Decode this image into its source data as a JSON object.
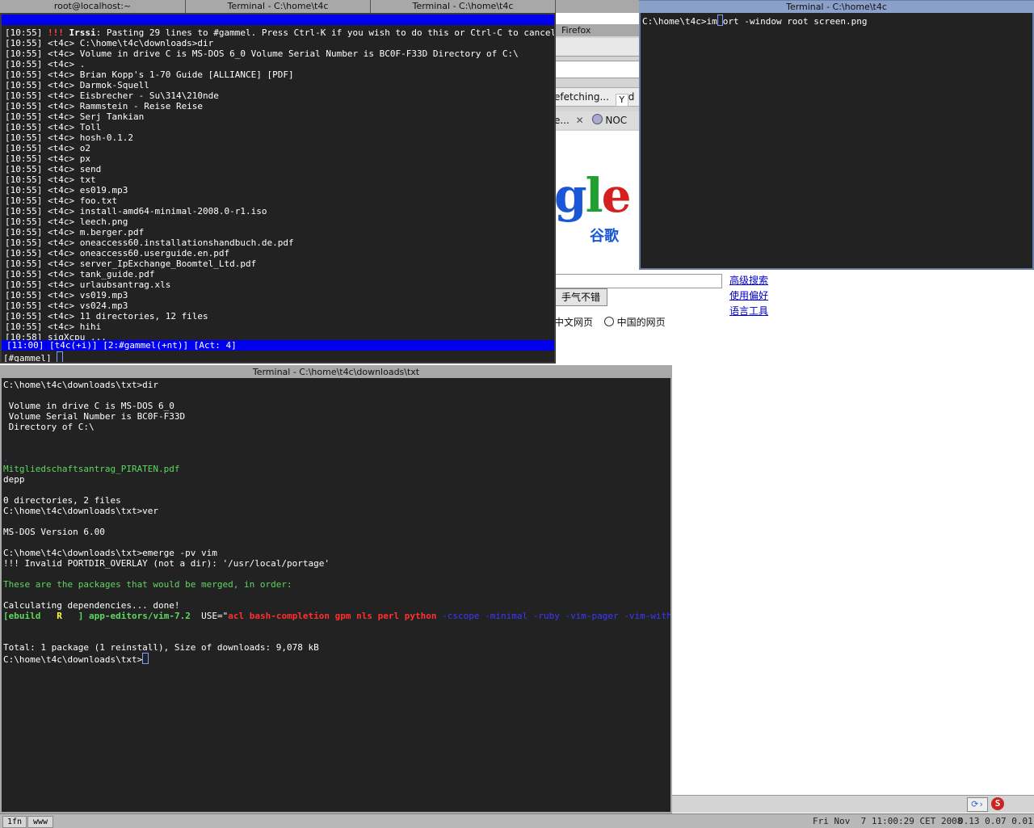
{
  "tabs": [
    {
      "label": "root@localhost:~"
    },
    {
      "label": "Terminal - C:\\home\\t4c"
    },
    {
      "label": "Terminal - C:\\home\\t4c"
    }
  ],
  "irssi": {
    "lines": [
      {
        "ts": "[10:55]",
        "nick": "",
        "text": "",
        "special": "paste"
      },
      {
        "ts": "[10:55]",
        "nick": "<t4c>",
        "text": "C:\\home\\t4c\\downloads>dir"
      },
      {
        "ts": "[10:55]",
        "nick": "<t4c>",
        "text": "Volume in drive C is MS-DOS 6_0 Volume Serial Number is BC0F-F33D Directory of C:\\"
      },
      {
        "ts": "[10:55]",
        "nick": "<t4c>",
        "text": "."
      },
      {
        "ts": "[10:55]",
        "nick": "<t4c>",
        "text": "Brian Kopp's 1-70 Guide [ALLIANCE] [PDF]"
      },
      {
        "ts": "[10:55]",
        "nick": "<t4c>",
        "text": "Darmok-Squell"
      },
      {
        "ts": "[10:55]",
        "nick": "<t4c>",
        "text": "Eisbrecher - Su\\314\\210nde"
      },
      {
        "ts": "[10:55]",
        "nick": "<t4c>",
        "text": "Rammstein - Reise Reise"
      },
      {
        "ts": "[10:55]",
        "nick": "<t4c>",
        "text": "Serj Tankian"
      },
      {
        "ts": "[10:55]",
        "nick": "<t4c>",
        "text": "Toll"
      },
      {
        "ts": "[10:55]",
        "nick": "<t4c>",
        "text": "hosh-0.1.2"
      },
      {
        "ts": "[10:55]",
        "nick": "<t4c>",
        "text": "o2"
      },
      {
        "ts": "[10:55]",
        "nick": "<t4c>",
        "text": "px"
      },
      {
        "ts": "[10:55]",
        "nick": "<t4c>",
        "text": "send"
      },
      {
        "ts": "[10:55]",
        "nick": "<t4c>",
        "text": "txt"
      },
      {
        "ts": "[10:55]",
        "nick": "<t4c>",
        "text": "es019.mp3"
      },
      {
        "ts": "[10:55]",
        "nick": "<t4c>",
        "text": "foo.txt"
      },
      {
        "ts": "[10:55]",
        "nick": "<t4c>",
        "text": "install-amd64-minimal-2008.0-r1.iso"
      },
      {
        "ts": "[10:55]",
        "nick": "<t4c>",
        "text": "leech.png"
      },
      {
        "ts": "[10:55]",
        "nick": "<t4c>",
        "text": "m.berger.pdf"
      },
      {
        "ts": "[10:55]",
        "nick": "<t4c>",
        "text": "oneaccess60.installationshandbuch.de.pdf"
      },
      {
        "ts": "[10:55]",
        "nick": "<t4c>",
        "text": "oneaccess60.userguide.en.pdf"
      },
      {
        "ts": "[10:55]",
        "nick": "<t4c>",
        "text": "server_IpExchange_Boomtel_Ltd.pdf"
      },
      {
        "ts": "[10:55]",
        "nick": "<t4c>",
        "text": "tank_guide.pdf"
      },
      {
        "ts": "[10:55]",
        "nick": "<t4c>",
        "text": "urlaubsantrag.xls"
      },
      {
        "ts": "[10:55]",
        "nick": "<t4c>",
        "text": "vs019.mp3"
      },
      {
        "ts": "[10:55]",
        "nick": "<t4c>",
        "text": "vs024.mp3"
      },
      {
        "ts": "[10:55]",
        "nick": "<t4c>",
        "text": "11 directories, 12 files"
      },
      {
        "ts": "[10:55]",
        "nick": "<t4c>",
        "text": "hihi"
      },
      {
        "ts": "[10:58]",
        "nick": "",
        "text": "sigXcpu ...",
        "special": "action"
      }
    ],
    "paste_prefix": "!!!",
    "paste_app": "Irssi",
    "paste_msg": ": Pasting 29 lines to #gammel. Press Ctrl-K if you wish to do this or Ctrl-C to cancel.",
    "status_line": "[11:00] [t4c(+i)] [2:#gammel(+nt)] [Act: 4]",
    "prompt": "[#gammel]"
  },
  "term_right": {
    "title": "Terminal - C:\\home\\t4c",
    "prompt": "C:\\home\\t4c>im",
    "command_rest": "ort -window root screen.png"
  },
  "term_main": {
    "title": "Terminal - C:\\home\\t4c\\downloads\\txt",
    "lines": [
      {
        "text": "C:\\home\\t4c\\downloads\\txt>dir",
        "color": "white"
      },
      {
        "text": "",
        "color": "white"
      },
      {
        "text": " Volume in drive C is MS-DOS 6_0",
        "color": "white"
      },
      {
        "text": " Volume Serial Number is BC0F-F33D",
        "color": "white"
      },
      {
        "text": " Directory of C:\\",
        "color": "white"
      },
      {
        "text": "",
        "color": "white"
      },
      {
        "text": "",
        "color": "white"
      },
      {
        "text": ".",
        "color": "blue"
      },
      {
        "text": "Mitgliedschaftsantrag_PIRATEN.pdf",
        "color": "green"
      },
      {
        "text": "depp",
        "color": "white"
      },
      {
        "text": "",
        "color": "white"
      },
      {
        "text": "0 directories, 2 files",
        "color": "white"
      },
      {
        "text": "C:\\home\\t4c\\downloads\\txt>ver",
        "color": "white"
      },
      {
        "text": "",
        "color": "white"
      },
      {
        "text": "MS-DOS Version 6.00",
        "color": "white"
      },
      {
        "text": "",
        "color": "white"
      },
      {
        "text": "C:\\home\\t4c\\downloads\\txt>emerge -pv vim",
        "color": "white"
      },
      {
        "text": "!!! Invalid PORTDIR_OVERLAY (not a dir): '/usr/local/portage'",
        "color": "white"
      },
      {
        "text": "",
        "color": "white"
      },
      {
        "text": "These are the packages that would be merged, in order:",
        "color": "green"
      },
      {
        "text": "",
        "color": "white"
      },
      {
        "text": "Calculating dependencies... done!",
        "color": "white"
      }
    ],
    "ebuild": {
      "open": "[",
      "tag": "ebuild",
      "flag": "R",
      "close": "]",
      "pkg": "app-editors/vim-7.2",
      "use_prefix": "USE=\"",
      "use_on": "acl bash-completion gpm nls perl python",
      "use_off": "-cscope -minimal -ruby -vim-pager -vim-with-x",
      "use_suffix": "\"",
      "size": "9,078 kB"
    },
    "after": [
      {
        "text": "",
        "color": "white"
      },
      {
        "text": "",
        "color": "white"
      },
      {
        "text": "Total: 1 package (1 reinstall), Size of downloads: 9,078 kB",
        "color": "white"
      }
    ],
    "prompt": "C:\\home\\t4c\\downloads\\txt>"
  },
  "firefox": {
    "title_fragment": "Firefox",
    "tab1": "efetching...",
    "tab2": "e...",
    "tab3": "NOC",
    "logo_text": "gle",
    "logo_cn": "谷歌",
    "lucky_button": "手气不错",
    "links": [
      "高级搜索",
      "使用偏好",
      "语言工具"
    ],
    "radio1": "中文网页",
    "radio2": "中国的网页"
  },
  "statusbar": {
    "ws1": "1fn",
    "ws2": "www",
    "clock": "Fri Nov  7 11:00:29 CET 2008",
    "load": "0.13 0.07 0.01"
  },
  "colors": {
    "term_bg": "#222222",
    "irssi_blue": "#0000ee",
    "title_active": "#4a6fa8",
    "title_inactive": "#a8a8a8"
  }
}
